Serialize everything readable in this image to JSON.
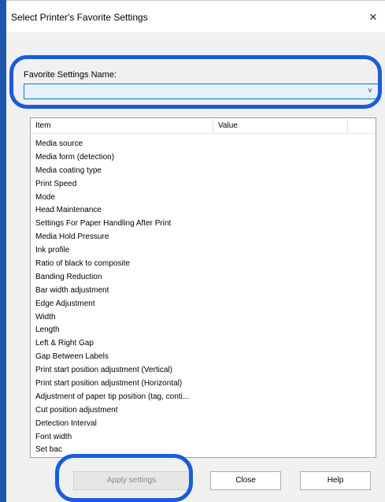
{
  "window": {
    "title": "Select Printer's Favorite Settings",
    "close_glyph": "×"
  },
  "favorite": {
    "label": "Favorite Settings Name:",
    "value": "",
    "dropdown_glyph": "˅"
  },
  "table": {
    "headers": {
      "item": "Item",
      "value": "Value"
    },
    "rows": [
      "Media source",
      "Media form (detection)",
      "Media coating type",
      "Print Speed",
      "Mode",
      "Head Maintenance",
      "Settings For Paper Handling After Print",
      "Media Hold Pressure",
      "Ink profile",
      "Ratio of black to composite",
      "Banding Reduction",
      "Bar width adjustment",
      "Edge Adjustment",
      "Width",
      "Length",
      "Left & Right Gap",
      "Gap Between Labels",
      "Print start position adjustment (Vertical)",
      "Print start position adjustment (Horizontal)",
      "Adjustment of paper tip position (tag, conti...",
      "Cut position adjustment",
      "Detection Interval",
      "Font width",
      "Set bac"
    ]
  },
  "buttons": {
    "apply": "Apply settings",
    "close": "Close",
    "help": "Help"
  },
  "colors": {
    "highlight": "#1a5cdb",
    "combo_focus": "#0078d7"
  }
}
